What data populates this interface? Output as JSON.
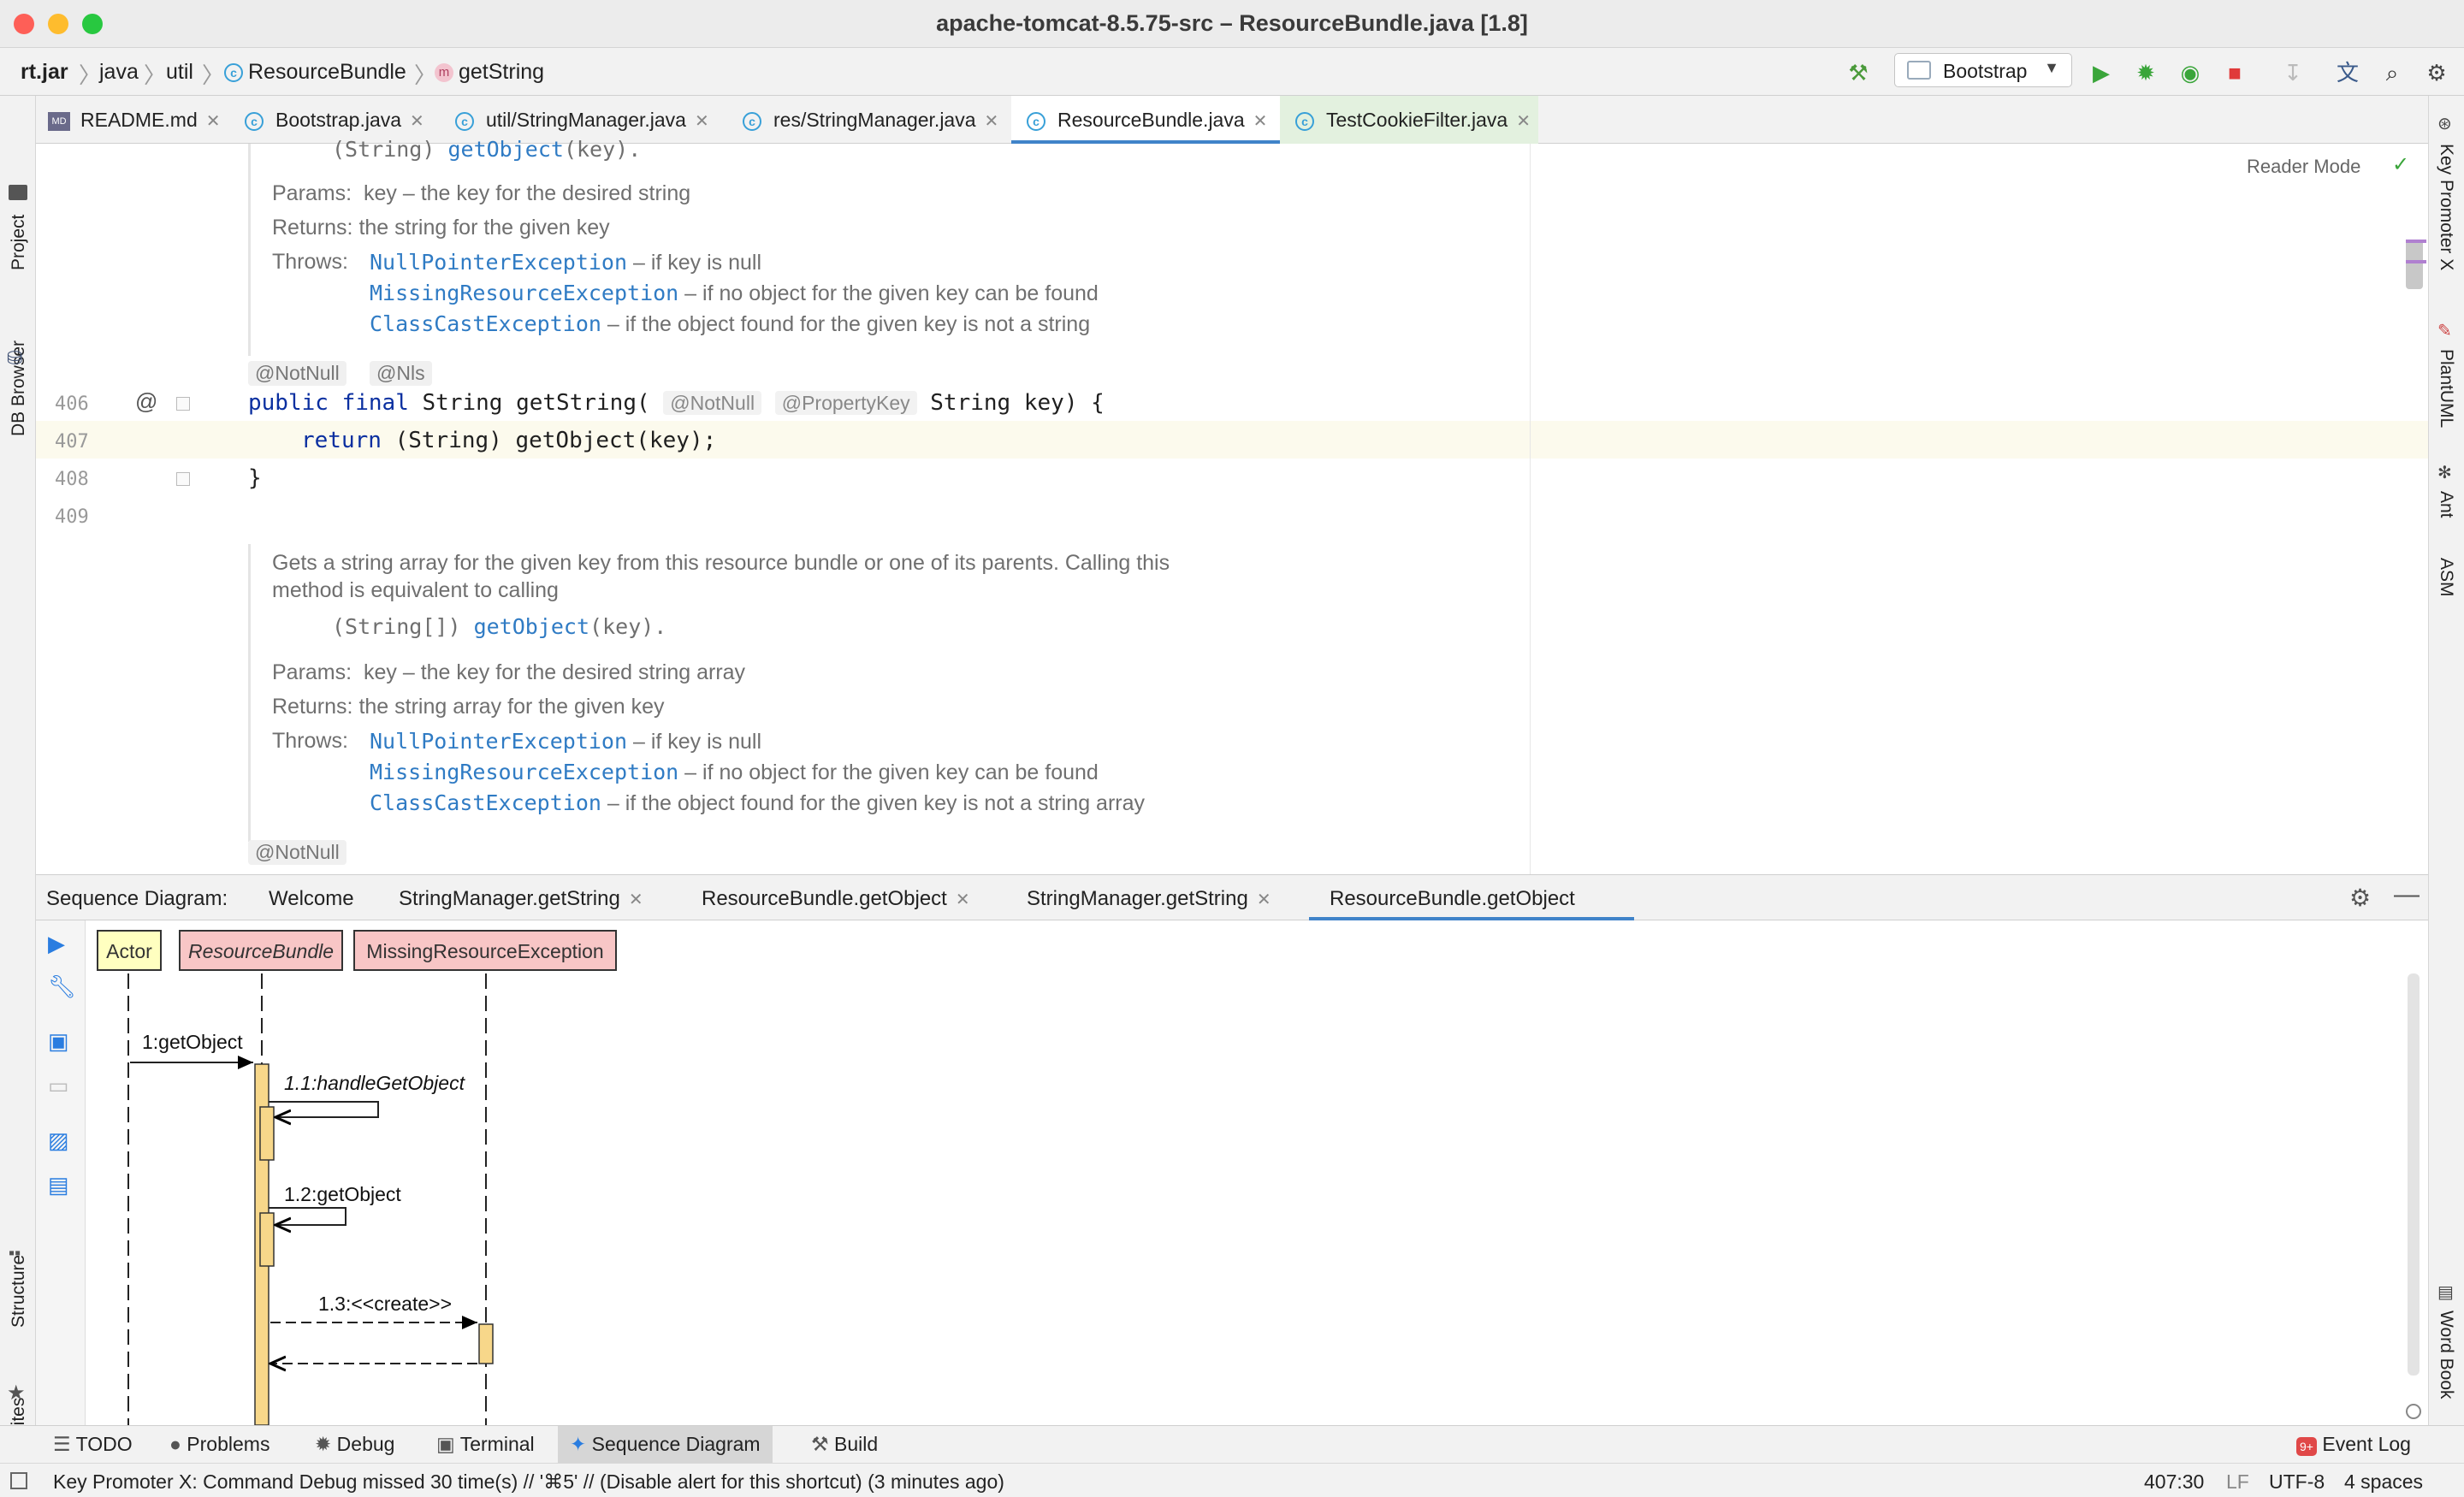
{
  "window": {
    "title": "apache-tomcat-8.5.75-src – ResourceBundle.java [1.8]"
  },
  "navbar": {
    "breadcrumbs": [
      "rt.jar",
      "java",
      "util",
      "ResourceBundle",
      "getString"
    ],
    "run_config": "Bootstrap"
  },
  "left_tools": {
    "project": "Project",
    "db_browser": "DB Browser",
    "structure": "Structure",
    "favorites": "Favorites"
  },
  "right_tools": {
    "key_promoter": "Key Promoter X",
    "plantuml": "PlantUML",
    "ant": "Ant",
    "asm": "ASM",
    "word_book": "Word Book"
  },
  "file_tabs": [
    {
      "label": "README.md",
      "icon": "markdown-icon"
    },
    {
      "label": "Bootstrap.java",
      "icon": "class-icon"
    },
    {
      "label": "util/StringManager.java",
      "icon": "class-icon"
    },
    {
      "label": "res/StringManager.java",
      "icon": "class-icon"
    },
    {
      "label": "ResourceBundle.java",
      "icon": "class-icon",
      "active": true
    },
    {
      "label": "TestCookieFilter.java",
      "icon": "class-icon"
    }
  ],
  "editor": {
    "reader_mode": "Reader Mode",
    "doc1": {
      "code_line_prefix": "(String) ",
      "code_line_link": "getObject",
      "code_line_suffix": "(key).",
      "params_label": "Params:",
      "params_text": "key – the key for the desired string",
      "returns_label": "Returns:",
      "returns_text": "the string for the given key",
      "throws_label": "Throws:",
      "throws": [
        {
          "ex": "NullPointerException",
          "text": " – if key is null"
        },
        {
          "ex": "MissingResourceException",
          "text": " – if no object for the given key can be found"
        },
        {
          "ex": "ClassCastException",
          "text": " – if the object found for the given key is not a string"
        }
      ]
    },
    "annotations1": [
      "@NotNull",
      "@Nls"
    ],
    "lines": [
      {
        "num": "406",
        "code": {
          "kw1": "public",
          "kw2": "final",
          "type": "String",
          "method": "getString(",
          "hint1": "@NotNull",
          "hint2": "@PropertyKey",
          "rest": "String key) {"
        }
      },
      {
        "num": "407",
        "code": {
          "kw": "return",
          "rest": "(String) getObject(key);"
        }
      },
      {
        "num": "408",
        "code": {
          "rest": "}"
        }
      },
      {
        "num": "409",
        "code": {
          "rest": ""
        }
      }
    ],
    "doc2": {
      "desc_line1": "Gets a string array for the given key from this resource bundle or one of its parents. Calling this",
      "desc_line2": "method is equivalent to calling",
      "code_line_prefix": "(String[]) ",
      "code_line_link": "getObject",
      "code_line_suffix": "(key).",
      "params_label": "Params:",
      "params_text": "key – the key for the desired string array",
      "returns_label": "Returns:",
      "returns_text": "the string array for the given key",
      "throws_label": "Throws:",
      "throws": [
        {
          "ex": "NullPointerException",
          "text": " – if key is null"
        },
        {
          "ex": "MissingResourceException",
          "text": " – if no object for the given key can be found"
        },
        {
          "ex": "ClassCastException",
          "text": " – if the object found for the given key is not a string array"
        }
      ]
    },
    "annotation2": "@NotNull"
  },
  "sequence_panel": {
    "label": "Sequence Diagram:",
    "tabs": [
      {
        "label": "Welcome",
        "closable": false
      },
      {
        "label": "StringManager.getString",
        "closable": true
      },
      {
        "label": "ResourceBundle.getObject",
        "closable": true
      },
      {
        "label": "StringManager.getString",
        "closable": true
      },
      {
        "label": "ResourceBundle.getObject",
        "closable": false,
        "active": true
      }
    ],
    "diagram": {
      "participants": [
        "Actor",
        "ResourceBundle",
        "MissingResourceException"
      ],
      "messages": [
        "1:getObject",
        "1.1:handleGetObject",
        "1.2:getObject",
        "1.3:<<create>>"
      ]
    }
  },
  "bottom_tools": [
    "TODO",
    "Problems",
    "Debug",
    "Terminal",
    "Sequence Diagram",
    "Build"
  ],
  "event_log": "Event Log",
  "status": {
    "message": "Key Promoter X: Command Debug missed 30 time(s) // '⌘5' // (Disable alert for this shortcut) (3 minutes ago)",
    "position": "407:30",
    "line_sep": "LF",
    "encoding": "UTF-8",
    "indent": "4 spaces"
  },
  "colors": {
    "accent": "#4083c9",
    "link": "#2f7bc4",
    "keyword": "#0a2fa0",
    "actor_box": "#ffffc0",
    "class_box": "#f8c6c6",
    "activation": "#f7d78a"
  }
}
